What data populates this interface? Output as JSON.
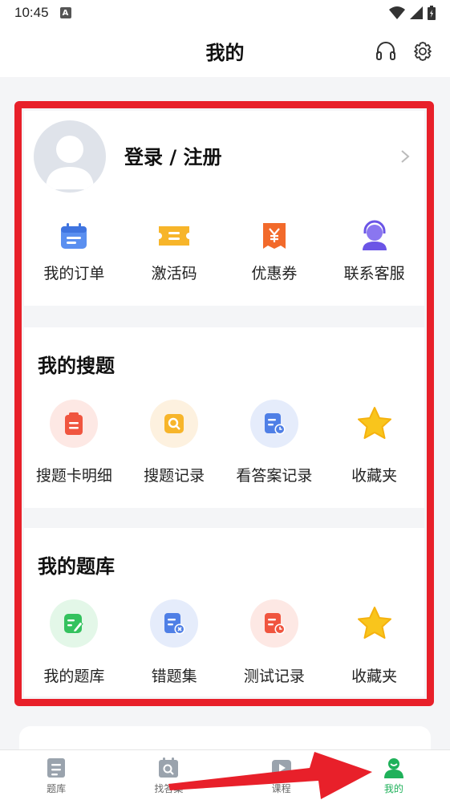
{
  "status_bar": {
    "time": "10:45",
    "indicator": "A"
  },
  "header": {
    "title": "我的",
    "icons": [
      "headset-icon",
      "settings-gear-icon"
    ]
  },
  "profile": {
    "login_label": "登录 / 注册"
  },
  "account_actions": [
    {
      "label": "我的订单",
      "icon": "order-calendar-icon"
    },
    {
      "label": "激活码",
      "icon": "activation-ticket-icon"
    },
    {
      "label": "优惠券",
      "icon": "coupon-yen-icon"
    },
    {
      "label": "联系客服",
      "icon": "customer-service-icon"
    }
  ],
  "my_search": {
    "title": "我的搜题",
    "items": [
      {
        "label": "搜题卡明细",
        "icon": "search-card-icon"
      },
      {
        "label": "搜题记录",
        "icon": "search-record-icon"
      },
      {
        "label": "看答案记录",
        "icon": "answer-record-icon"
      },
      {
        "label": "收藏夹",
        "icon": "star-icon"
      }
    ]
  },
  "my_bank": {
    "title": "我的题库",
    "items": [
      {
        "label": "我的题库",
        "icon": "question-bank-icon"
      },
      {
        "label": "错题集",
        "icon": "wrong-questions-icon"
      },
      {
        "label": "测试记录",
        "icon": "test-record-icon"
      },
      {
        "label": "收藏夹",
        "icon": "star-icon"
      }
    ]
  },
  "tab_bar": [
    {
      "label": "题库",
      "icon": "document-icon",
      "active": false
    },
    {
      "label": "找答案",
      "icon": "search-answer-icon",
      "active": false
    },
    {
      "label": "课程",
      "icon": "play-video-icon",
      "active": false
    },
    {
      "label": "我的",
      "icon": "person-icon",
      "active": true
    }
  ],
  "colors": {
    "accent": "#1fb15a",
    "highlight": "#e8202a",
    "background": "#f4f5f7"
  }
}
